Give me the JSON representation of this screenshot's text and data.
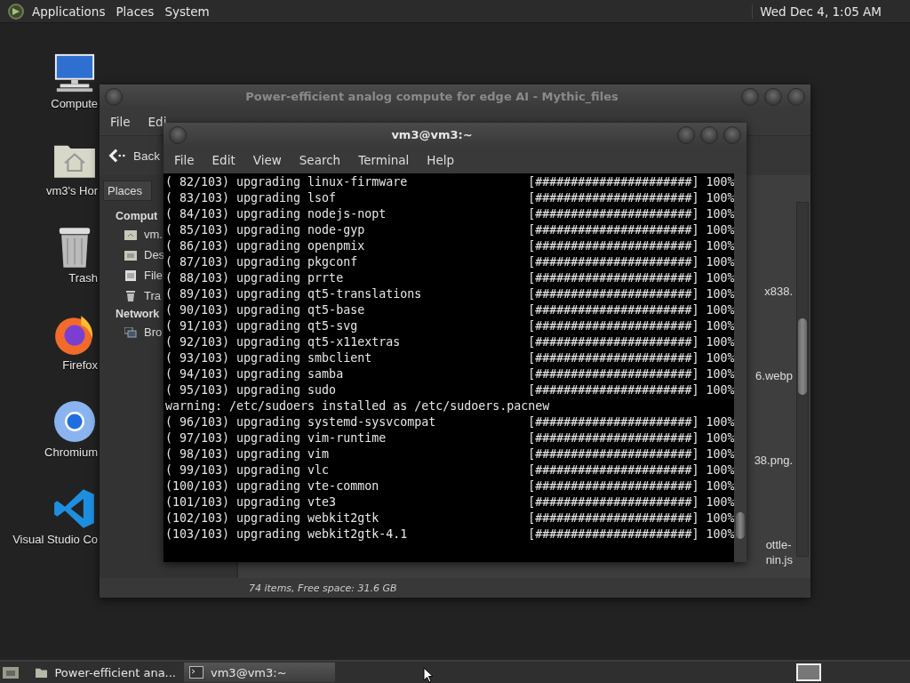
{
  "top_panel": {
    "menus": [
      "Applications",
      "Places",
      "System"
    ],
    "clock": "Wed Dec 4, 1:05 AM"
  },
  "desktop_icons": [
    {
      "label": "Compute",
      "kind": "computer"
    },
    {
      "label": "vm3's Hor",
      "kind": "home"
    },
    {
      "label": "Trash",
      "kind": "trash"
    },
    {
      "label": "Firefox",
      "kind": "firefox"
    },
    {
      "label": "Chromium",
      "kind": "chromium"
    },
    {
      "label": "Visual Studio Co",
      "kind": "vscode"
    }
  ],
  "file_manager": {
    "title": "Power-efficient analog compute for edge AI - Mythic_files",
    "menus": [
      "File",
      "Edi"
    ],
    "back": "Back",
    "sidebar": {
      "dropdown": "Places",
      "sections": [
        {
          "heading": "Comput",
          "items": [
            {
              "label": "vm.",
              "kind": "home"
            },
            {
              "label": "Des",
              "kind": "folder"
            },
            {
              "label": "File",
              "kind": "drive"
            },
            {
              "label": "Tra",
              "kind": "trash"
            }
          ]
        },
        {
          "heading": "Network",
          "items": [
            {
              "label": "Bro",
              "kind": "network"
            }
          ]
        }
      ]
    },
    "files": [
      {
        "lines": [
          "x838."
        ]
      },
      {
        "lines": [
          "6.webp"
        ]
      },
      {
        "lines": [
          "38.png."
        ]
      },
      {
        "lines": [
          "ottle-",
          "nin.js"
        ]
      }
    ],
    "status": "74 items, Free space: 31.6 GB"
  },
  "terminal": {
    "title": "vm3@vm3:~",
    "menus": [
      "File",
      "Edit",
      "View",
      "Search",
      "Terminal",
      "Help"
    ],
    "lines": [
      {
        "kind": "progress",
        "step": "( 82/103)",
        "action": "upgrading",
        "package": "linux-firmware",
        "bar": "[######################]",
        "percent": "100%"
      },
      {
        "kind": "progress",
        "step": "( 83/103)",
        "action": "upgrading",
        "package": "lsof",
        "bar": "[######################]",
        "percent": "100%"
      },
      {
        "kind": "progress",
        "step": "( 84/103)",
        "action": "upgrading",
        "package": "nodejs-nopt",
        "bar": "[######################]",
        "percent": "100%"
      },
      {
        "kind": "progress",
        "step": "( 85/103)",
        "action": "upgrading",
        "package": "node-gyp",
        "bar": "[######################]",
        "percent": "100%"
      },
      {
        "kind": "progress",
        "step": "( 86/103)",
        "action": "upgrading",
        "package": "openpmix",
        "bar": "[######################]",
        "percent": "100%"
      },
      {
        "kind": "progress",
        "step": "( 87/103)",
        "action": "upgrading",
        "package": "pkgconf",
        "bar": "[######################]",
        "percent": "100%"
      },
      {
        "kind": "progress",
        "step": "( 88/103)",
        "action": "upgrading",
        "package": "prrte",
        "bar": "[######################]",
        "percent": "100%"
      },
      {
        "kind": "progress",
        "step": "( 89/103)",
        "action": "upgrading",
        "package": "qt5-translations",
        "bar": "[######################]",
        "percent": "100%"
      },
      {
        "kind": "progress",
        "step": "( 90/103)",
        "action": "upgrading",
        "package": "qt5-base",
        "bar": "[######################]",
        "percent": "100%"
      },
      {
        "kind": "progress",
        "step": "( 91/103)",
        "action": "upgrading",
        "package": "qt5-svg",
        "bar": "[######################]",
        "percent": "100%"
      },
      {
        "kind": "progress",
        "step": "( 92/103)",
        "action": "upgrading",
        "package": "qt5-x11extras",
        "bar": "[######################]",
        "percent": "100%"
      },
      {
        "kind": "progress",
        "step": "( 93/103)",
        "action": "upgrading",
        "package": "smbclient",
        "bar": "[######################]",
        "percent": "100%"
      },
      {
        "kind": "progress",
        "step": "( 94/103)",
        "action": "upgrading",
        "package": "samba",
        "bar": "[######################]",
        "percent": "100%"
      },
      {
        "kind": "progress",
        "step": "( 95/103)",
        "action": "upgrading",
        "package": "sudo",
        "bar": "[######################]",
        "percent": "100%"
      },
      {
        "kind": "message",
        "text": "warning: /etc/sudoers installed as /etc/sudoers.pacnew"
      },
      {
        "kind": "progress",
        "step": "( 96/103)",
        "action": "upgrading",
        "package": "systemd-sysvcompat",
        "bar": "[######################]",
        "percent": "100%"
      },
      {
        "kind": "progress",
        "step": "( 97/103)",
        "action": "upgrading",
        "package": "vim-runtime",
        "bar": "[######################]",
        "percent": "100%"
      },
      {
        "kind": "progress",
        "step": "( 98/103)",
        "action": "upgrading",
        "package": "vim",
        "bar": "[######################]",
        "percent": "100%"
      },
      {
        "kind": "progress",
        "step": "( 99/103)",
        "action": "upgrading",
        "package": "vlc",
        "bar": "[######################]",
        "percent": "100%"
      },
      {
        "kind": "progress",
        "step": "(100/103)",
        "action": "upgrading",
        "package": "vte-common",
        "bar": "[######################]",
        "percent": "100%"
      },
      {
        "kind": "progress",
        "step": "(101/103)",
        "action": "upgrading",
        "package": "vte3",
        "bar": "[######################]",
        "percent": "100%"
      },
      {
        "kind": "progress",
        "step": "(102/103)",
        "action": "upgrading",
        "package": "webkit2gtk",
        "bar": "[######################]",
        "percent": "100%"
      },
      {
        "kind": "progress",
        "step": "(103/103)",
        "action": "upgrading",
        "package": "webkit2gtk-4.1",
        "bar": "[######################]",
        "percent": "100%"
      }
    ]
  },
  "taskbar": {
    "items": [
      {
        "label": "Power-efficient ana...",
        "kind": "folder",
        "selected": false
      },
      {
        "label": "vm3@vm3:~",
        "kind": "terminal",
        "selected": true
      }
    ]
  }
}
